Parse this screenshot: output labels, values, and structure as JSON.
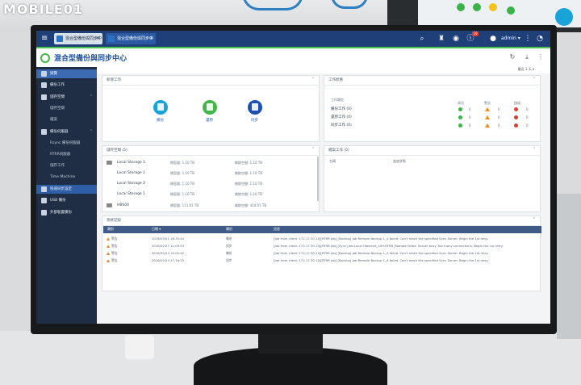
{
  "watermark": "MOBILE01",
  "topbar": {
    "tabs": [
      {
        "label": "混合型備份與同步中心"
      },
      {
        "label": "混合型備份與同步中心"
      }
    ],
    "notif_count": "10",
    "user": "admin ▾"
  },
  "app": {
    "title": "混合型備份與同步中心",
    "subtitle_right": "最近 1 天 ▾"
  },
  "sidebar": {
    "items": [
      {
        "label": "總覽"
      },
      {
        "label": "備份工作"
      },
      {
        "label": "儲存空間"
      },
      {
        "label": "儲存空間"
      },
      {
        "label": "檔案"
      },
      {
        "label": "備份伺服器"
      },
      {
        "label": "Rsync 備份伺服器"
      },
      {
        "label": "RTRR伺服器"
      },
      {
        "label": "儲存工作"
      },
      {
        "label": "Time Machine"
      },
      {
        "label": "快速同步設定"
      },
      {
        "label": "USB 備份"
      },
      {
        "label": "外部裝置備份"
      }
    ]
  },
  "create_panel": {
    "title": "新增工作",
    "items": [
      {
        "label": "備份",
        "color": "#1aa3d9"
      },
      {
        "label": "還原",
        "color": "#43b649"
      },
      {
        "label": "同步",
        "color": "#1e50b4"
      }
    ]
  },
  "status_panel": {
    "title": "工作狀態",
    "header": {
      "name": "工作類型",
      "ok": "成功",
      "warn": "警告",
      "err": "錯誤"
    },
    "rows": [
      {
        "name": "備份工作 (0)",
        "ok": "0",
        "warn": "0",
        "err": "0"
      },
      {
        "name": "還原工作 (0)",
        "ok": "0",
        "warn": "0",
        "err": "0"
      },
      {
        "name": "同步工作 (0)",
        "ok": "0",
        "warn": "0",
        "err": "0"
      }
    ]
  },
  "storage_panel": {
    "title": "儲存空間 (5)",
    "rows": [
      {
        "name": "Local Storage 1",
        "used": "總容量: 1.10 TB",
        "free": "剩餘空間: 1.10 TB"
      },
      {
        "name": "Local Storage 1",
        "used": "總容量: 1.10 TB",
        "free": "剩餘空間: 1.10 TB"
      },
      {
        "name": "Local Storage 2",
        "used": "總容量: 1.10 TB",
        "free": "剩餘空間: 1.10 TB"
      },
      {
        "name": "Local Storage 1",
        "used": "總容量: 1.10 TB",
        "free": "剩餘空間: 1.10 TB"
      },
      {
        "name": "HBS04",
        "used": "總容量: 111.01 TB",
        "free": "剩餘空間: 424.01 TB"
      }
    ]
  },
  "running_panel": {
    "title": "檔案工作 (0)",
    "col1": "名稱",
    "col2": "進度狀態"
  },
  "log_panel": {
    "title": "系統記錄",
    "headers": {
      "severity": "類別",
      "date": "日期 ▾",
      "type": "類別",
      "content": "訊息"
    },
    "rows": [
      {
        "severity": "警告",
        "date": "2016/03/01 16:35:44",
        "type": "備份",
        "content": "[Job from client: 172.17.30.15][RTRR Job] [Backup] Job Remote Backup 1_4 failed. Can't reach the specified Sync Server. Begin the 1st retry."
      },
      {
        "severity": "警告",
        "date": "2016/02/27 11:09:53",
        "type": "同步",
        "content": "[Job from client: 172.17.30.15][RTRR Job] [Sync] Job Local Hibernet_10H-RTRR_Remote failed. Server busy. Too many connections. Begin the 1st retry."
      },
      {
        "severity": "警告",
        "date": "2016/02/24 10:02:42",
        "type": "備份",
        "content": "[Job from client: 172.17.30.15][RTRR Job] [Backup] Job Remote Backup 1_4 failed. Can't reach the specified Sync Server. Begin the 1st retry."
      },
      {
        "severity": "警告",
        "date": "2016/02/24 17:16:22",
        "type": "同步",
        "content": "[Job from client: 172.17.30.15][RTRR Job] [Backup] Job Remote Backup 1_4 failed. Can't reach the specified Sync Server. Begin the 1st retry."
      }
    ]
  }
}
